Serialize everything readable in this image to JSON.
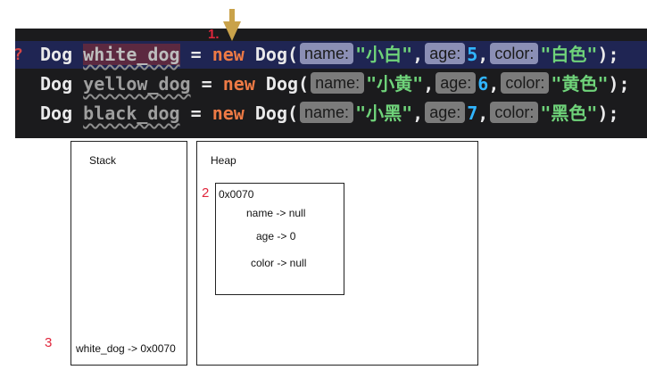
{
  "code": {
    "lines": [
      {
        "type": "Dog",
        "var": "white_dog",
        "eq": "=",
        "kw": "new",
        "ctor": "Dog(",
        "name_hint": "name:",
        "name_val": "\"小白\"",
        "comma1": ",",
        "age_hint": "age:",
        "age_val": "5",
        "comma2": ",",
        "color_hint": "color:",
        "color_val": "\"白色\"",
        "end": ");"
      },
      {
        "type": "Dog",
        "var": "yellow_dog",
        "eq": "=",
        "kw": "new",
        "ctor": "Dog(",
        "name_hint": "name:",
        "name_val": "\"小黄\"",
        "comma1": ",",
        "age_hint": "age:",
        "age_val": "6",
        "comma2": ",",
        "color_hint": "color:",
        "color_val": "\"黄色\"",
        "end": ");"
      },
      {
        "type": "Dog",
        "var": "black_dog",
        "eq": "=",
        "kw": "new",
        "ctor": "Dog(",
        "name_hint": "name:",
        "name_val": "\"小黑\"",
        "comma1": ",",
        "age_hint": "age:",
        "age_val": "7",
        "comma2": ",",
        "color_hint": "color:",
        "color_val": "\"黑色\"",
        "end": ");"
      }
    ]
  },
  "annotations": {
    "step1": "1.",
    "step2": "2",
    "step3": "3"
  },
  "stack": {
    "title": "Stack",
    "entry": "white_dog -> 0x0070"
  },
  "heap": {
    "title": "Heap",
    "object": {
      "address": "0x0070",
      "fields": [
        "name -> null",
        "age -> 0",
        "color -> null"
      ]
    }
  },
  "colors": {
    "editor_bg": "#1b1b1d",
    "active_line": "#1f2553",
    "keyword_new": "#ee7a45",
    "string": "#6fd37a",
    "number": "#31b5ff",
    "annotation": "#e0263c",
    "arrow": "#c9a24a"
  }
}
